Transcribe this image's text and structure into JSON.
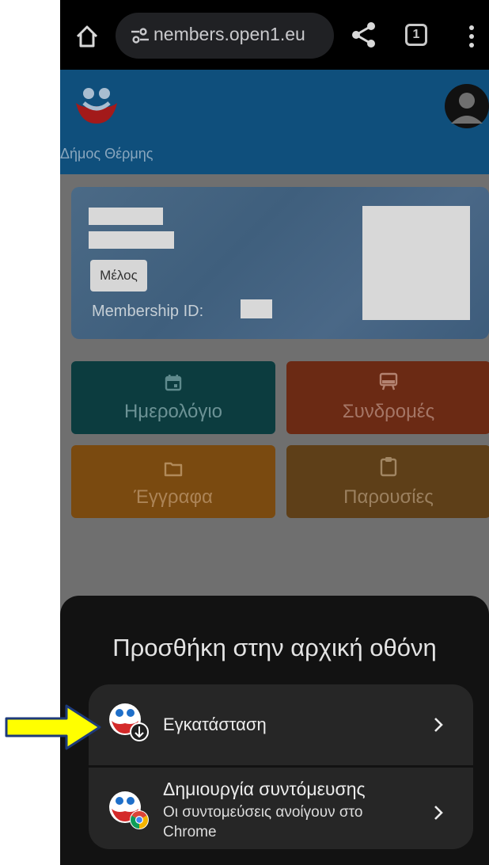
{
  "browser": {
    "url": "nembers.open1.eu",
    "tab_count": "1"
  },
  "app": {
    "org_name": "Δήμος Θέρμης"
  },
  "member_card": {
    "role": "Μέλος",
    "membership_label": "Membership ID:"
  },
  "tiles": [
    {
      "label": "Ημερολόγιο",
      "icon": "calendar-icon",
      "color": "#0c3c3f"
    },
    {
      "label": "Συνδρομές",
      "icon": "subscription-icon",
      "color": "#6b2a14"
    },
    {
      "label": "Έγγραφα",
      "icon": "folder-icon",
      "color": "#7a4a10"
    },
    {
      "label": "Παρουσίες",
      "icon": "clipboard-icon",
      "color": "#5e3f18"
    }
  ],
  "sheet": {
    "title": "Προσθήκη στην αρχική οθόνη",
    "options": [
      {
        "label": "Εγκατάσταση",
        "icon": "install-app-icon"
      },
      {
        "label": "Δημιουργία συντόμευσης",
        "sublabel": "Οι συντομεύσεις ανοίγουν στο Chrome",
        "icon": "shortcut-chrome-icon"
      }
    ]
  },
  "colors": {
    "annotation_arrow": "#ffff00",
    "sheet_bg": "#121212",
    "option_bg": "#262626"
  }
}
